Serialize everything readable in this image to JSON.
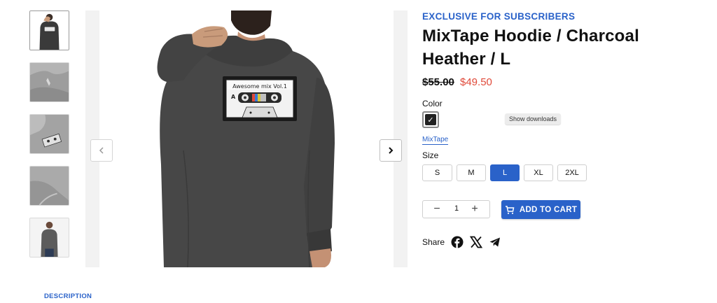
{
  "gallery": {
    "thumbnails": [
      {
        "icon": "hoodie-back-thumb",
        "active": true
      },
      {
        "icon": "hoodie-fabric-detail-thumb",
        "active": false
      },
      {
        "icon": "cassette-print-detail-thumb",
        "active": false
      },
      {
        "icon": "hoodie-cuff-detail-thumb",
        "active": false
      },
      {
        "icon": "model-front-thumb",
        "active": false
      }
    ],
    "main_image_icon": "hoodie-back-photo",
    "cassette_label_text": "Awesome mix Vol.1",
    "cassette_side": "A",
    "prev_icon": "chevron-left-icon",
    "next_icon": "chevron-right-icon"
  },
  "product": {
    "eyebrow": "EXCLUSIVE FOR SUBSCRIBERS",
    "title": "MixTape Hoodie / Charcoal Heather / L",
    "price_old": "$55.00",
    "price_new": "$49.50",
    "price_new_color": "#e04a3a",
    "accent_color": "#2a62c9"
  },
  "options": {
    "color_label": "Color",
    "color_swatch_check": "✓",
    "tooltip": "Show downloads",
    "collection_link": "MixTape",
    "size_label": "Size",
    "sizes": [
      "S",
      "M",
      "L",
      "XL",
      "2XL"
    ],
    "selected_size": "L"
  },
  "cart": {
    "quantity": "1",
    "minus": "−",
    "plus": "+",
    "add_to_cart": "ADD TO CART",
    "cart_icon": "cart-icon"
  },
  "share": {
    "label": "Share",
    "icons": [
      "facebook-icon",
      "x-icon",
      "telegram-icon"
    ]
  },
  "tabs": {
    "description": "DESCRIPTION"
  }
}
